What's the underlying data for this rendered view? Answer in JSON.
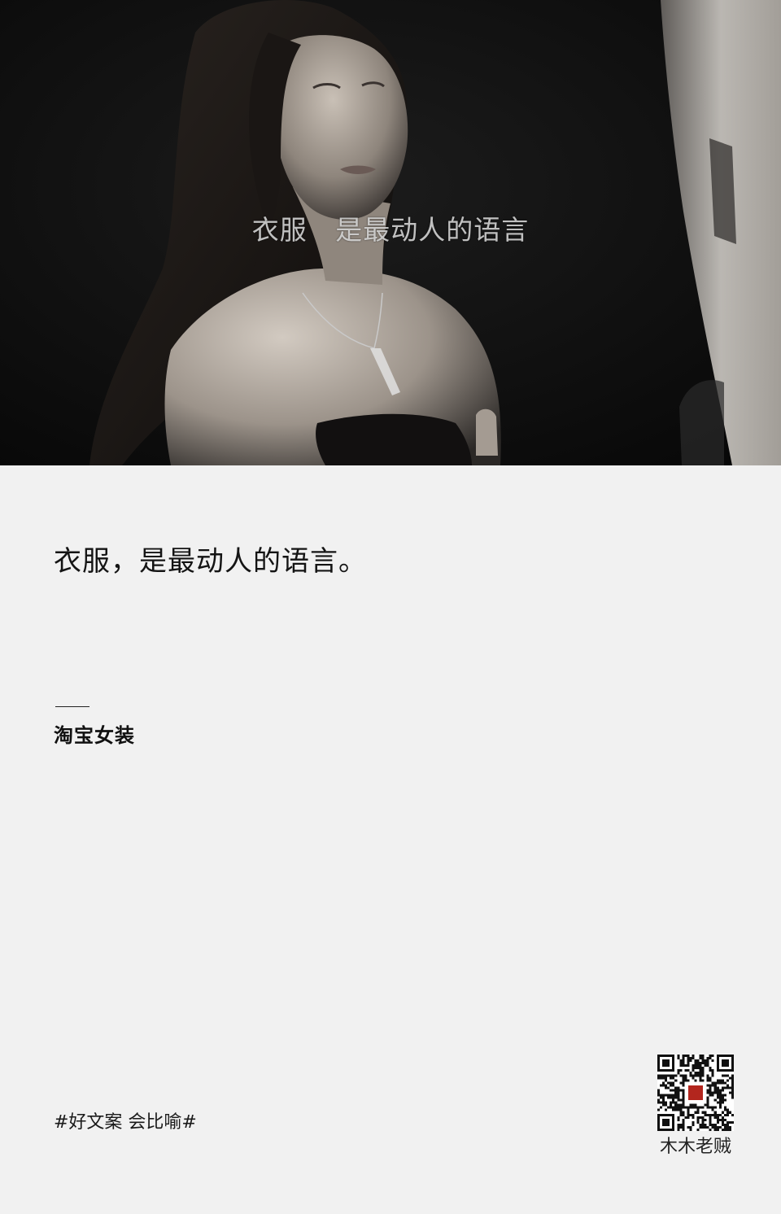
{
  "photo": {
    "subtitle": "衣服   是最动人的语言"
  },
  "copy": {
    "headline": "衣服，是最动人的语言。",
    "brand": "淘宝女装"
  },
  "footer": {
    "hashtag": "#好文案 会比喻#",
    "author": "木木老贼",
    "seal_text": "木木老贼"
  },
  "colors": {
    "background": "#f1f1f1",
    "photo_background": "#0c0c0c",
    "seal": "#b3261e"
  }
}
